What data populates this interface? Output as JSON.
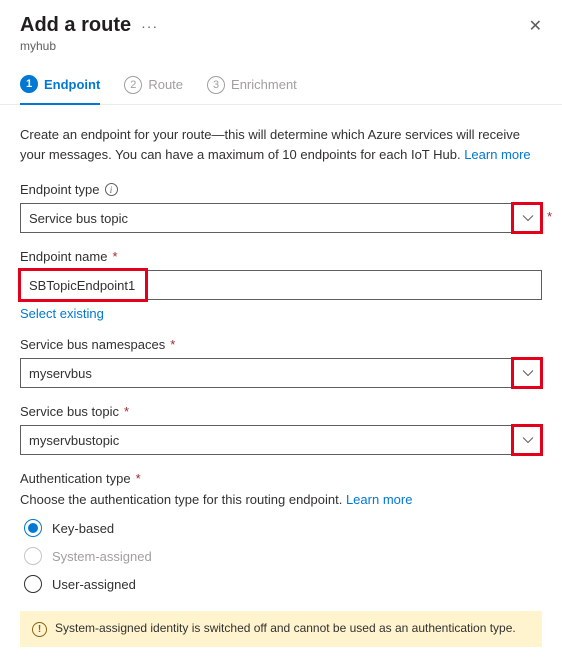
{
  "header": {
    "title": "Add a route",
    "subtitle": "myhub"
  },
  "steps": [
    {
      "num": "1",
      "label": "Endpoint",
      "active": true
    },
    {
      "num": "2",
      "label": "Route",
      "active": false
    },
    {
      "num": "3",
      "label": "Enrichment",
      "active": false
    }
  ],
  "intro": {
    "text": "Create an endpoint for your route—this will determine which Azure services will receive your messages. You can have a maximum of 10 endpoints for each IoT Hub. ",
    "link": "Learn more"
  },
  "fields": {
    "endpoint_type": {
      "label": "Endpoint type",
      "value": "Service bus topic"
    },
    "endpoint_name": {
      "label": "Endpoint name",
      "value": "SBTopicEndpoint1",
      "select_existing": "Select existing"
    },
    "sb_namespaces": {
      "label": "Service bus namespaces",
      "value": "myservbus"
    },
    "sb_topic": {
      "label": "Service bus topic",
      "value": "myservbustopic"
    },
    "auth_type": {
      "label": "Authentication type",
      "helper": "Choose the authentication type for this routing endpoint. ",
      "helper_link": "Learn more",
      "options": {
        "key": "Key-based",
        "system": "System-assigned",
        "user": "User-assigned"
      }
    }
  },
  "alert": "System-assigned identity is switched off and cannot be used as an authentication type."
}
